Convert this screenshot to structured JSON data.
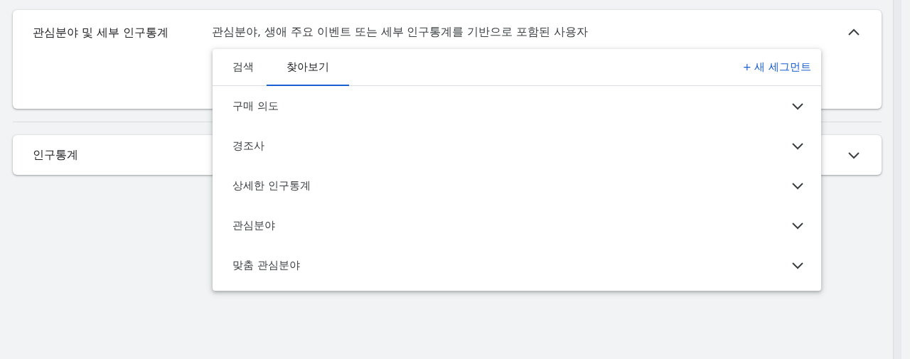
{
  "sections": [
    {
      "title": "관심분야 및 세부 인구통계",
      "description": "관심분야, 생애 주요 이벤트 또는 세부 인구통계를 기반으로 포함된 사용자",
      "expanded": true
    },
    {
      "title": "인구통계",
      "expanded": false
    }
  ],
  "dropdown": {
    "tabs": [
      {
        "label": "검색",
        "selected": false
      },
      {
        "label": "찾아보기",
        "selected": true
      }
    ],
    "new_segment": "+ 새 세그먼트",
    "categories": [
      {
        "label": "구매 의도",
        "expanded": false
      },
      {
        "label": "경조사",
        "expanded": false
      },
      {
        "label": "상세한 인구통계",
        "expanded": false
      },
      {
        "label": "관심분야",
        "expanded": false
      },
      {
        "label": "맞춤 관심분야",
        "expanded": false
      }
    ]
  }
}
